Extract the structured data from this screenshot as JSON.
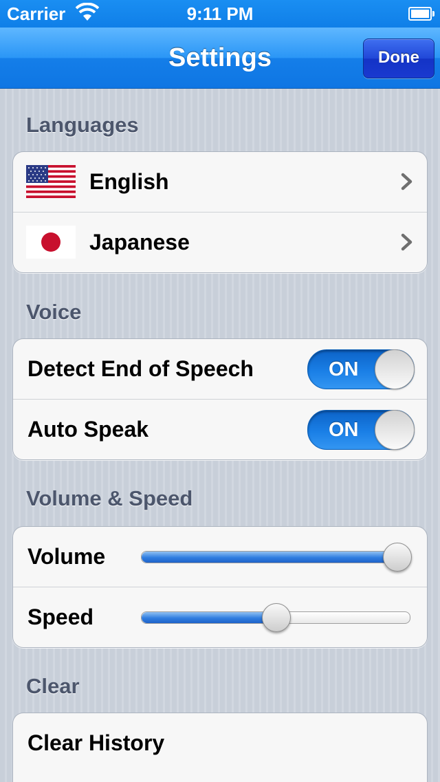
{
  "status_bar": {
    "carrier": "Carrier",
    "time": "9:11 PM",
    "wifi_icon": "wifi-icon",
    "battery_icon": "battery-icon"
  },
  "nav": {
    "title": "Settings",
    "done_label": "Done"
  },
  "sections": {
    "languages": {
      "header": "Languages",
      "items": [
        {
          "label": "English",
          "flag": "us-flag-icon"
        },
        {
          "label": "Japanese",
          "flag": "japan-flag-icon"
        }
      ]
    },
    "voice": {
      "header": "Voice",
      "items": [
        {
          "label": "Detect End of Speech",
          "toggle_text": "ON",
          "on": true
        },
        {
          "label": "Auto Speak",
          "toggle_text": "ON",
          "on": true
        }
      ]
    },
    "volume_speed": {
      "header": "Volume & Speed",
      "items": [
        {
          "label": "Volume",
          "value": 1.0
        },
        {
          "label": "Speed",
          "value": 0.5
        }
      ]
    },
    "clear": {
      "header": "Clear",
      "items": [
        {
          "label": "Clear History"
        }
      ]
    }
  },
  "colors": {
    "nav_blue": "#1a8ef2",
    "done_blue": "#2047d8",
    "toggle_blue": "#1a7fe6",
    "header_text": "#4c566c"
  }
}
